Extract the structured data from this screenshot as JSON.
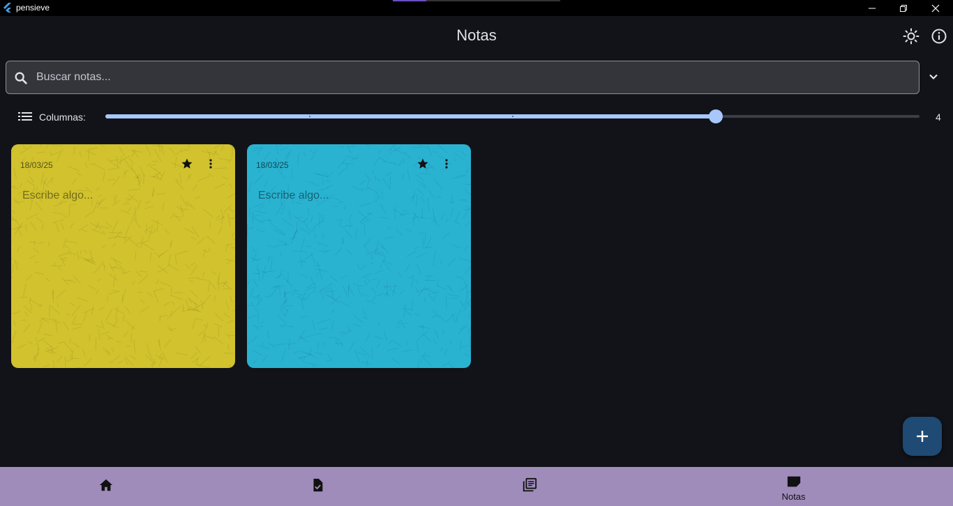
{
  "window": {
    "title": "pensieve",
    "controls": [
      "minimize-icon",
      "restore-icon",
      "close-icon"
    ]
  },
  "header": {
    "title": "Notas",
    "actions": [
      "brightness-icon",
      "info-icon"
    ]
  },
  "search": {
    "placeholder": "Buscar notas...",
    "value": ""
  },
  "columns": {
    "label": "Columnas:",
    "value": "4",
    "slider_fraction": 0.75,
    "min": 1,
    "max": 5
  },
  "notes": [
    {
      "date": "18/03/25",
      "placeholder": "Escribe algo...",
      "color": "#d1c22e",
      "starred": true
    },
    {
      "date": "18/03/25",
      "placeholder": "Escribe algo...",
      "color": "#29b3d1",
      "starred": true
    }
  ],
  "fab": {
    "icon": "add-icon"
  },
  "bottom_nav": {
    "items": [
      {
        "icon": "home-icon",
        "label": ""
      },
      {
        "icon": "task-icon",
        "label": ""
      },
      {
        "icon": "library-icon",
        "label": ""
      },
      {
        "icon": "note-icon",
        "label": "Notas"
      }
    ],
    "selected": 3
  },
  "colors": {
    "background": "#111318",
    "accent": "#a8c7fa",
    "nav_background": "#a08cbb",
    "fab": "#1e4a73"
  }
}
